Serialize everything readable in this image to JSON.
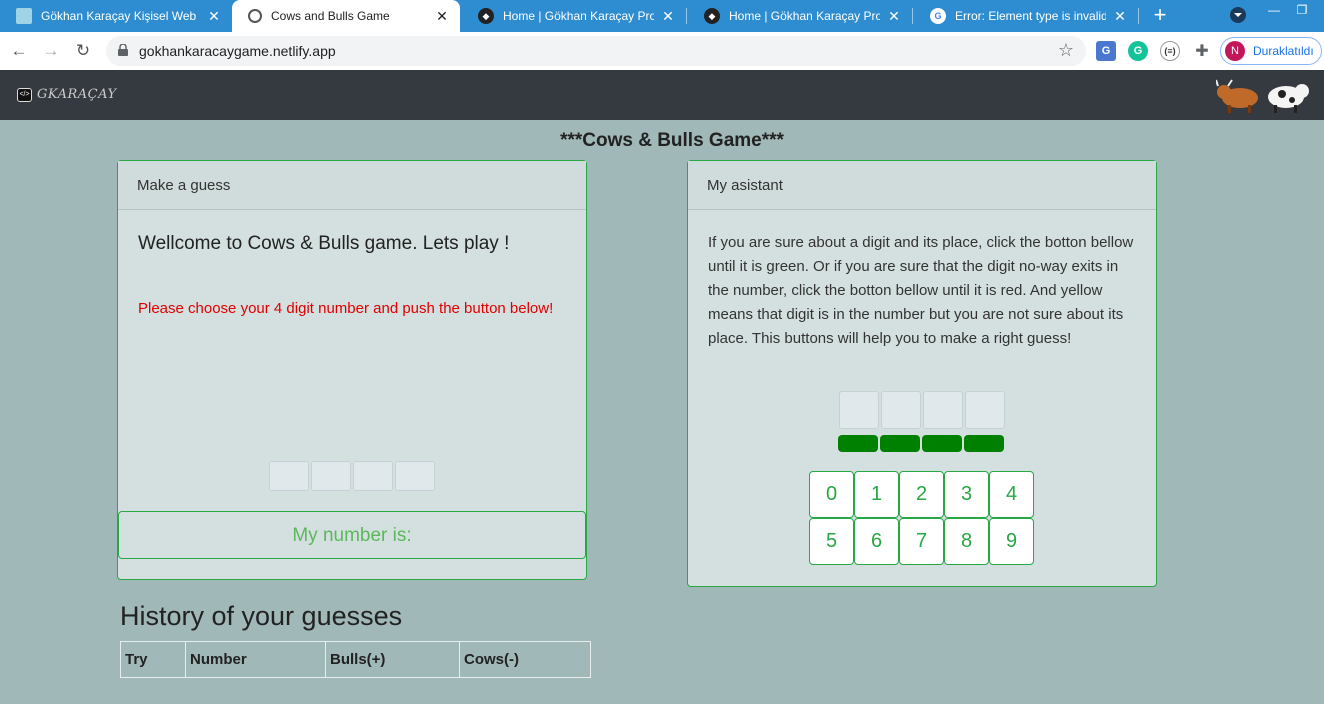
{
  "browser": {
    "tabs": [
      {
        "title": "Gökhan Karaçay Kişisel Web Sit",
        "favicon": "image-favicon",
        "active": false
      },
      {
        "title": "Cows and Bulls Game",
        "favicon": "globe-favicon",
        "active": true
      },
      {
        "title": "Home | Gökhan Karaçay Projec",
        "favicon": "netlify-favicon",
        "active": false
      },
      {
        "title": "Home | Gökhan Karaçay Projec",
        "favicon": "netlify-favicon",
        "active": false
      },
      {
        "title": "Error: Element type is invalid: e",
        "favicon": "google-favicon",
        "active": false
      }
    ],
    "url": "gokhankaracaygame.netlify.app",
    "profile_label": "Duraklatıldı",
    "profile_initial": "N",
    "accent_color": "#2d8dd0"
  },
  "site": {
    "logo_text": "GKARAÇAY",
    "logo_badge": "</>"
  },
  "game": {
    "title": "***Cows & Bulls Game***",
    "guess_card": {
      "header": "Make a guess",
      "welcome": "Wellcome to Cows & Bulls game. Lets play !",
      "prompt": "Please choose your 4 digit number and push the button below!",
      "my_number_label": "My number is:"
    },
    "assistant_card": {
      "header": "My asistant",
      "instructions": "If you are sure about a digit and its place, click the botton bellow until it is green. Or if you are sure that the digit no-way exits in the number, click the botton bellow until it is red. And yellow means that digit is in the number but you are not sure about its place. This buttons will help you to make a right guess!",
      "digits": [
        "0",
        "1",
        "2",
        "3",
        "4",
        "5",
        "6",
        "7",
        "8",
        "9"
      ]
    },
    "history": {
      "title": "History of your guesses",
      "columns": [
        "Try",
        "Number",
        "Bulls(+)",
        "Cows(-)"
      ]
    },
    "colors": {
      "background": "#a0b8b8",
      "success": "#28a745",
      "error_text": "#e00000",
      "status_green": "#008000"
    }
  }
}
